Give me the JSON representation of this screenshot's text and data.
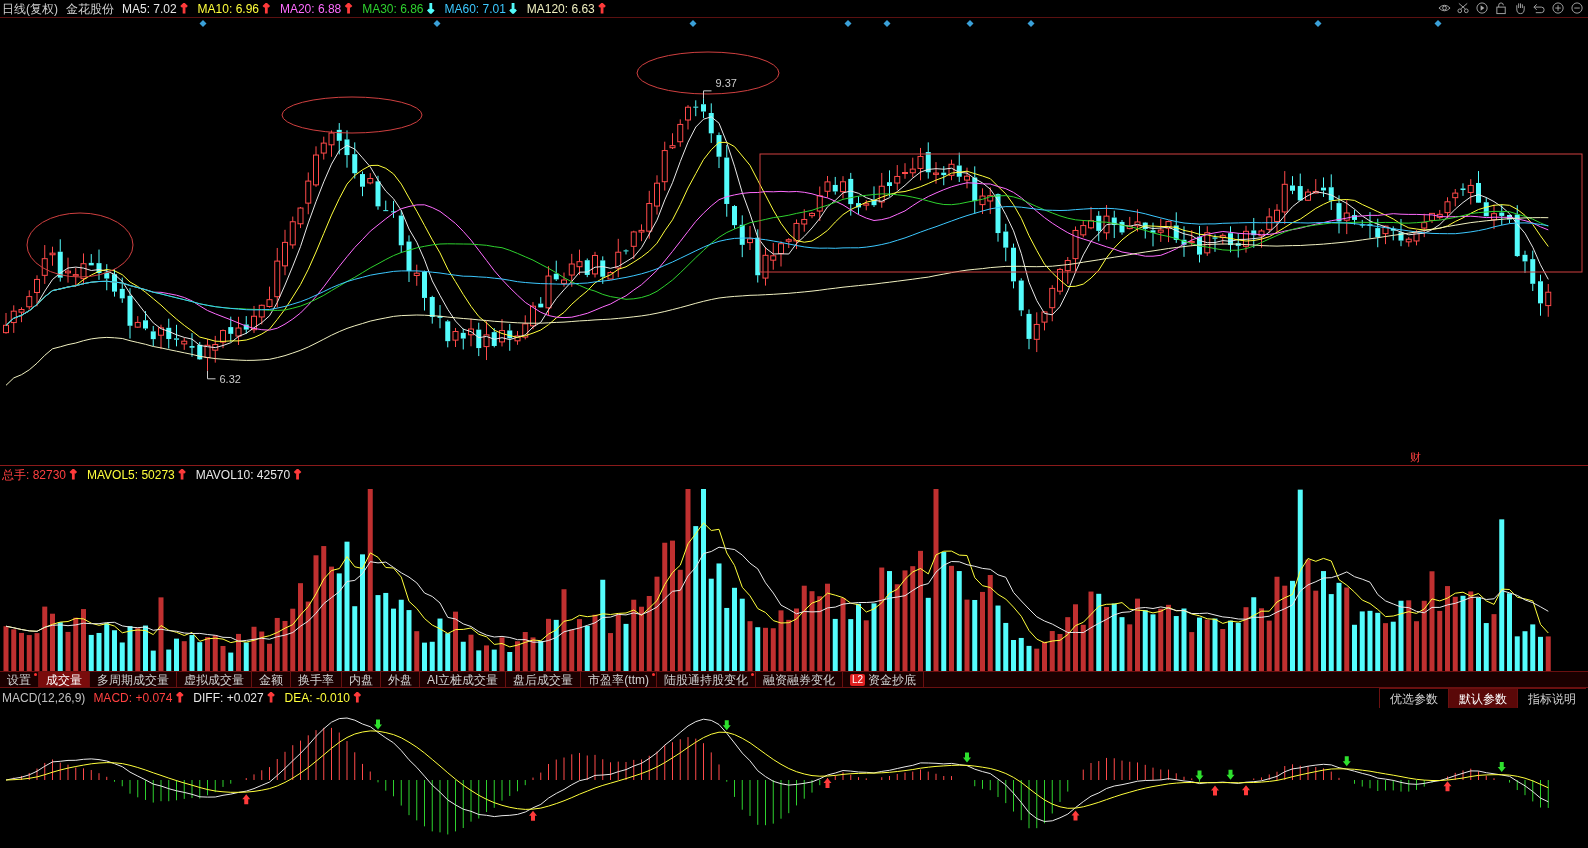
{
  "price_header": {
    "title": "日线(复权)",
    "stock": "金花股份",
    "indicators": [
      {
        "label": "MA5: 7.02",
        "arrow": {
          "text": "↑",
          "color": "#ff3b3b"
        },
        "color": "#e8e8e8"
      },
      {
        "label": "MA10: 6.96",
        "arrow": {
          "text": "↑",
          "color": "#ff3b3b"
        },
        "color": "#ffff3c"
      },
      {
        "label": "MA20: 6.88",
        "arrow": {
          "text": "↑",
          "color": "#ff3b3b"
        },
        "color": "#ff6cff"
      },
      {
        "label": "MA30: 6.86",
        "arrow": {
          "text": "↓",
          "color": "#54fcfc"
        },
        "color": "#2ed12e"
      },
      {
        "label": "MA60: 7.01",
        "arrow": {
          "text": "↓",
          "color": "#54fcfc"
        },
        "color": "#3cc8ff"
      },
      {
        "label": "MA120: 6.63",
        "arrow": {
          "text": "↑",
          "color": "#ff3b3b"
        },
        "color": "#f0f0c0"
      }
    ]
  },
  "price_chart": {
    "high_label": "9.37",
    "low_label": "6.32",
    "finance_badge": "财"
  },
  "volume_header": {
    "indicators": [
      {
        "label": "总手: 82730",
        "arrow": {
          "text": "↑",
          "color": "#ff3b3b"
        },
        "color": "#ff4040"
      },
      {
        "label": "MAVOL5: 50273",
        "arrow": {
          "text": "↑",
          "color": "#ff3b3b"
        },
        "color": "#ffff3c"
      },
      {
        "label": "MAVOL10: 42570",
        "arrow": {
          "text": "↑",
          "color": "#ff3b3b"
        },
        "color": "#e8e8e8"
      }
    ]
  },
  "tabs": [
    {
      "label": "设置",
      "selected": false,
      "dot": true
    },
    {
      "label": "成交量",
      "selected": true,
      "dot": false
    },
    {
      "label": "多周期成交量",
      "selected": false,
      "dot": false
    },
    {
      "label": "虚拟成交量",
      "selected": false,
      "dot": false
    },
    {
      "label": "金额",
      "selected": false,
      "dot": false
    },
    {
      "label": "换手率",
      "selected": false,
      "dot": false
    },
    {
      "label": "内盘",
      "selected": false,
      "dot": false
    },
    {
      "label": "外盘",
      "selected": false,
      "dot": false
    },
    {
      "label": "AI立桩成交量",
      "selected": false,
      "dot": false
    },
    {
      "label": "盘后成交量",
      "selected": false,
      "dot": false
    },
    {
      "label": "市盈率(ttm)",
      "selected": false,
      "dot": true
    },
    {
      "label": "陆股通持股变化",
      "selected": false,
      "dot": true
    },
    {
      "label": "融资融券变化",
      "selected": false,
      "dot": false
    },
    {
      "label": "资金抄底",
      "selected": false,
      "dot": false,
      "badge": "L2"
    }
  ],
  "macd_header": {
    "title": "MACD(12,26,9)",
    "indicators": [
      {
        "label": "MACD: +0.074",
        "arrow": {
          "text": "↑",
          "color": "#ff3b3b"
        },
        "color": "#ff4040"
      },
      {
        "label": "DIFF: +0.027",
        "arrow": {
          "text": "↑",
          "color": "#ff3b3b"
        },
        "color": "#e8e8e8"
      },
      {
        "label": "DEA: -0.010",
        "arrow": {
          "text": "↑",
          "color": "#ff3b3b"
        },
        "color": "#ffff3c"
      }
    ]
  },
  "param_buttons": [
    {
      "label": "优选参数",
      "selected": false
    },
    {
      "label": "默认参数",
      "selected": true
    },
    {
      "label": "指标说明",
      "selected": false
    }
  ]
}
